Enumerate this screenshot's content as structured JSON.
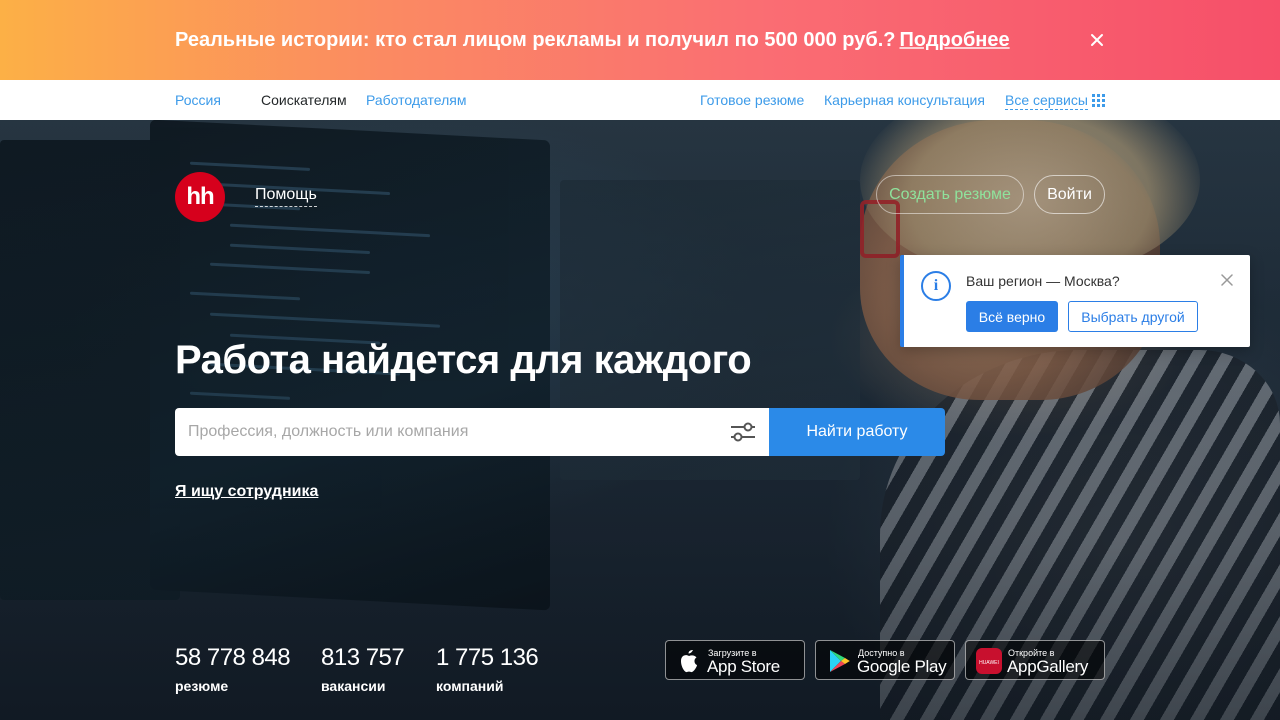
{
  "promo": {
    "text": "Реальные истории: кто стал лицом рекламы и получил по 500 000 руб.?",
    "link": "Подробнее"
  },
  "topnav": {
    "region": "Россия",
    "seekers": "Соискателям",
    "employers": "Работодателям",
    "ready_resume": "Готовое резюме",
    "career": "Карьерная консультация",
    "all_services": "Все сервисы"
  },
  "header": {
    "logo": "hh",
    "help": "Помощь",
    "create_resume": "Создать резюме",
    "login": "Войти"
  },
  "region_popup": {
    "icon": "i",
    "question": "Ваш регион — Москва?",
    "yes": "Всё верно",
    "other": "Выбрать другой"
  },
  "hero": {
    "headline": "Работа найдется для каждого",
    "search_placeholder": "Профессия, должность или компания",
    "search_value": "",
    "search_button": "Найти работу",
    "employer_link": "Я ищу сотрудника"
  },
  "stats": [
    {
      "number": "58 778 848",
      "label": "резюме"
    },
    {
      "number": "813 757",
      "label": "вакансии"
    },
    {
      "number": "1 775 136",
      "label": "компаний"
    }
  ],
  "stores": [
    {
      "small": "Загрузите в",
      "big": "App Store",
      "icon": "apple-icon"
    },
    {
      "small": "Доступно в",
      "big": "Google Play",
      "icon": "google-play-icon"
    },
    {
      "small": "Откройте в",
      "big": "AppGallery",
      "icon": "huawei-appgallery-icon",
      "icon_text": "HUAWEI"
    }
  ],
  "colors": {
    "accent": "#2b8ae8",
    "link": "#3d9be9",
    "brand_red": "#d6001c",
    "resume_green": "#8fe29c"
  }
}
